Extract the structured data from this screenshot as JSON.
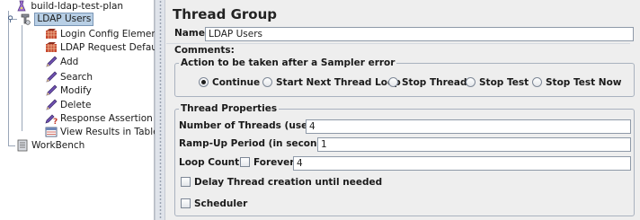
{
  "tree": {
    "root_label": "build-ldap-test-plan",
    "thread_group_label": "LDAP Users",
    "children": [
      {
        "label": "Login Config Element",
        "icon": "config-element-icon"
      },
      {
        "label": "LDAP Request Defaults",
        "icon": "config-element-icon"
      },
      {
        "label": "Add",
        "icon": "sampler-icon"
      },
      {
        "label": "Search",
        "icon": "sampler-icon"
      },
      {
        "label": "Modify",
        "icon": "sampler-icon"
      },
      {
        "label": "Delete",
        "icon": "sampler-icon"
      },
      {
        "label": "Response Assertion",
        "icon": "assertion-icon"
      },
      {
        "label": "View Results in Table",
        "icon": "listener-icon"
      }
    ],
    "workbench_label": "WorkBench"
  },
  "panel": {
    "title": "Thread Group",
    "name_label": "Name:",
    "name_value": "LDAP Users",
    "comments_label": "Comments:",
    "sampler_error": {
      "legend": "Action to be taken after a Sampler error",
      "options": [
        "Continue",
        "Start Next Thread Loop",
        "Stop Thread",
        "Stop Test",
        "Stop Test Now"
      ],
      "selected": "Continue"
    },
    "thread_properties": {
      "legend": "Thread Properties",
      "num_threads_label": "Number of Threads (users):",
      "num_threads_value": "4",
      "ramp_up_label": "Ramp-Up Period (in seconds):",
      "ramp_up_value": "1",
      "loop_count_label": "Loop Count:",
      "forever_label": "Forever",
      "forever_checked": false,
      "loop_count_value": "4",
      "delay_label": "Delay Thread creation until needed",
      "delay_checked": false,
      "scheduler_label": "Scheduler",
      "scheduler_checked": false
    }
  },
  "colors": {
    "selection": "#b8cfe5",
    "panel_bg": "#eeeeee",
    "border": "#a9b2bf"
  }
}
